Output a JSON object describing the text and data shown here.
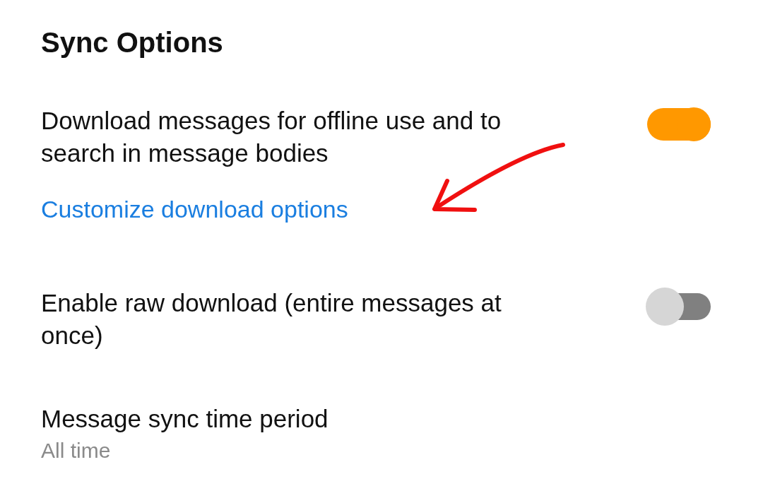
{
  "title": "Sync Options",
  "settings": [
    {
      "kind": "toggle",
      "label": "Download messages for offline use and to search in message bodies",
      "on": true,
      "link": "Customize download options"
    },
    {
      "kind": "toggle",
      "label": "Enable raw download (entire messages at once)",
      "on": false
    },
    {
      "kind": "value",
      "label": "Message sync time period",
      "value": "All time"
    }
  ]
}
